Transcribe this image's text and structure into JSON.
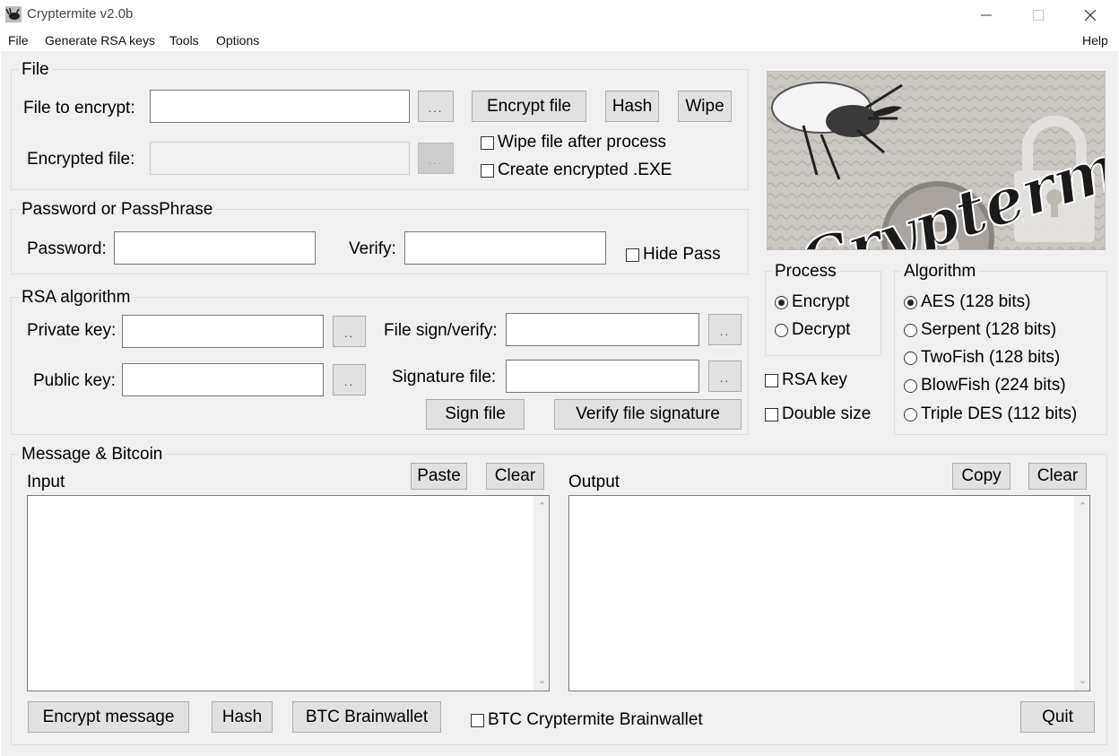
{
  "window": {
    "title": "Cryptermite v2.0b",
    "icons": [
      "app-bug-icon",
      "minimize-icon",
      "maximize-icon",
      "close-icon"
    ]
  },
  "menu": {
    "file": "File",
    "rsa": "Generate RSA keys",
    "tools": "Tools",
    "options": "Options",
    "help": "Help"
  },
  "file_group": {
    "title": "File",
    "file_to_encrypt_label": "File to encrypt:",
    "encrypted_file_label": "Encrypted file:",
    "browse": "...",
    "encrypt_button": "Encrypt file",
    "hash_button": "Hash",
    "wipe_button": "Wipe",
    "wipe_after_label": "Wipe file after process",
    "wipe_after_checked": false,
    "create_exe_label": "Create encrypted .EXE",
    "create_exe_checked": false
  },
  "password_group": {
    "title": "Password or PassPhrase",
    "password_label": "Password:",
    "verify_label": "Verify:",
    "hide_pass_label": "Hide Pass",
    "hide_pass_checked": false
  },
  "rsa_group": {
    "title": "RSA algorithm",
    "private_key_label": "Private key:",
    "public_key_label": "Public key:",
    "file_sign_label": "File sign/verify:",
    "signature_file_label": "Signature file:",
    "browse": "..",
    "sign_button": "Sign file",
    "verify_button": "Verify file signature"
  },
  "logo": {
    "text": "Cryptermite"
  },
  "process_group": {
    "title": "Process",
    "encrypt": "Encrypt",
    "decrypt": "Decrypt",
    "selected": "Encrypt"
  },
  "rsa_key_label": "RSA key",
  "double_size_label": "Double size",
  "algorithm_group": {
    "title": "Algorithm",
    "options": [
      "AES (128 bits)",
      "Serpent (128 bits)",
      "TwoFish (128 bits)",
      "BlowFish (224 bits)",
      "Triple DES (112 bits)"
    ],
    "selected": "AES (128 bits)"
  },
  "message_group": {
    "title": "Message & Bitcoin",
    "input_label": "Input",
    "output_label": "Output",
    "paste_button": "Paste",
    "clear_button": "Clear",
    "copy_button": "Copy",
    "encrypt_message_button": "Encrypt message",
    "hash_button": "Hash",
    "btc_brainwallet_button": "BTC Brainwallet",
    "btc_cryptermite_label": "BTC Cryptermite Brainwallet",
    "btc_cryptermite_checked": false,
    "quit_button": "Quit"
  }
}
